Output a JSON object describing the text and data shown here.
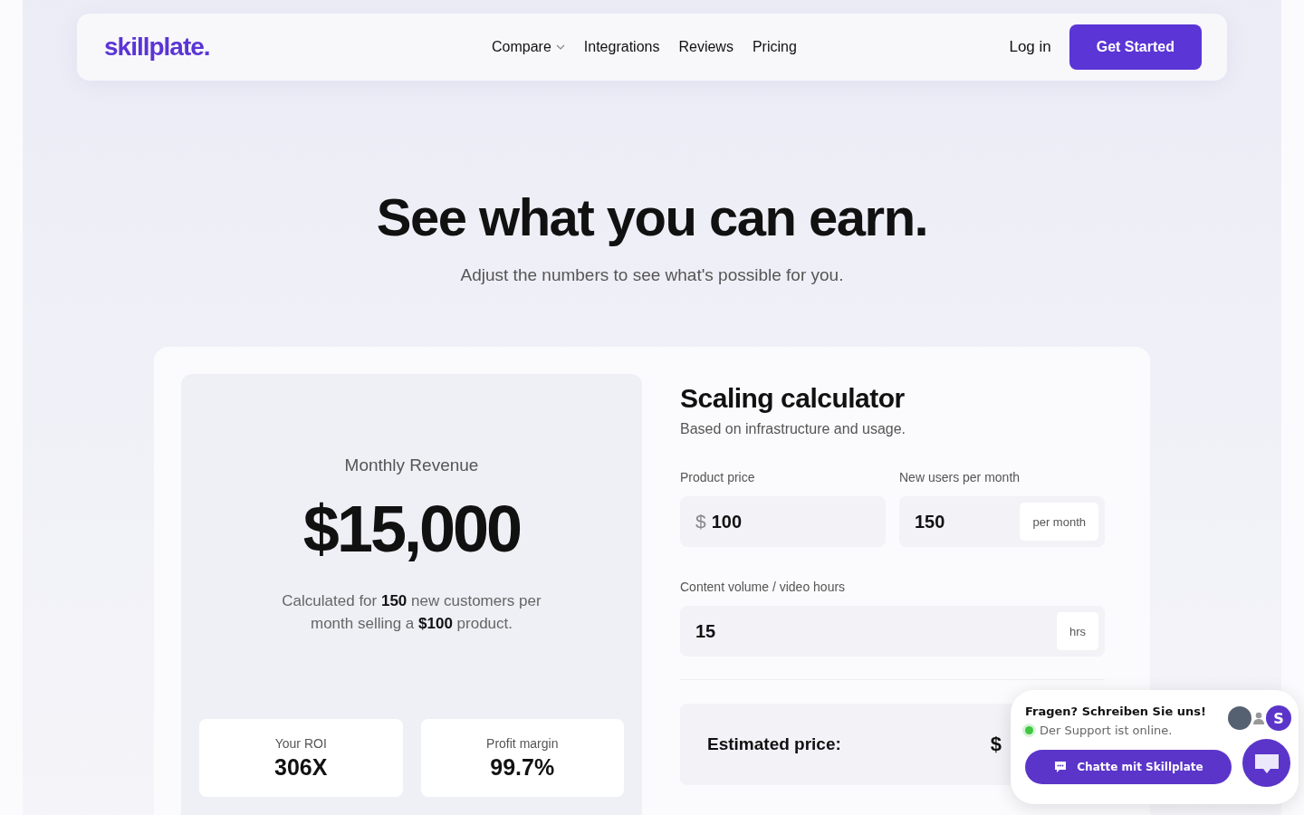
{
  "nav": {
    "logo": "skillplate.",
    "links": [
      {
        "label": "Compare",
        "dropdown": true
      },
      {
        "label": "Integrations",
        "dropdown": false
      },
      {
        "label": "Reviews",
        "dropdown": false
      },
      {
        "label": "Pricing",
        "dropdown": false
      }
    ],
    "login": "Log in",
    "cta": "Get Started"
  },
  "hero": {
    "title": "See what you can earn.",
    "subtitle": "Adjust the numbers to see what's possible for you."
  },
  "revenue": {
    "label": "Monthly Revenue",
    "value": "$15,000",
    "summary": "Calculated for **150** new customers per month selling a **$100** product.",
    "stats": [
      {
        "label": "Your ROI",
        "value": "306X"
      },
      {
        "label": "Profit margin",
        "value": "99.7%"
      }
    ]
  },
  "calculator": {
    "title": "Scaling calculator",
    "subtitle": "Based on infrastructure and usage.",
    "fields": [
      {
        "label": "Product price",
        "prefix": "$",
        "value": "100",
        "wide": false
      },
      {
        "label": "New users per month",
        "value": "150",
        "suffix": "per month",
        "wide": false
      },
      {
        "label": "Content volume / video hours",
        "value": "15",
        "suffix": "hrs",
        "wide": true
      }
    ],
    "estimate": {
      "label": "Estimated price:",
      "value": "$"
    }
  },
  "chat": {
    "title": "Fragen? Schreiben Sie uns!",
    "status": "Der Support ist online.",
    "online": true,
    "badge": "S",
    "button": "Chatte mit Skillplate"
  }
}
